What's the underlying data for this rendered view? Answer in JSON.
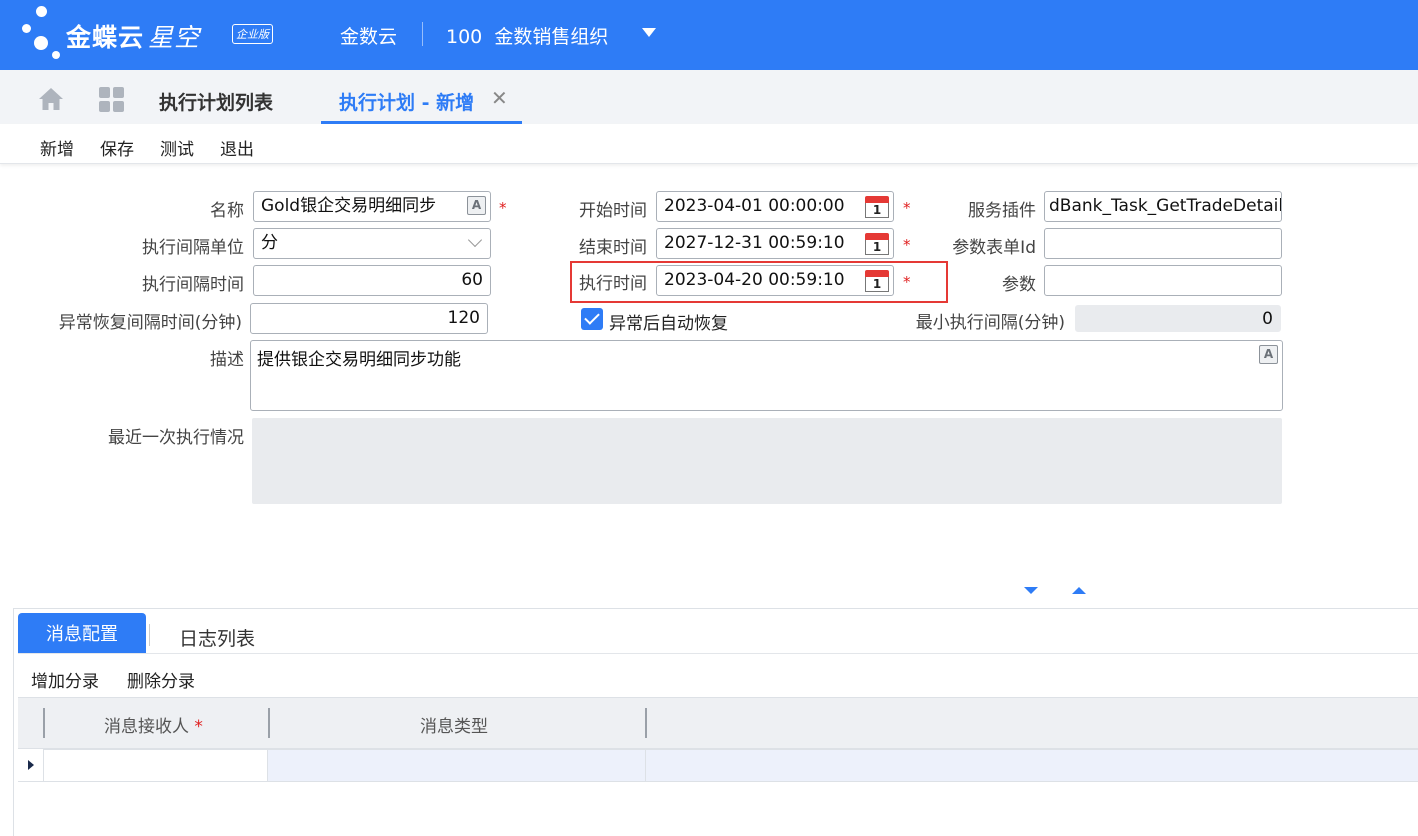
{
  "header": {
    "brand": "金蝶云",
    "brand_star": "星空",
    "edition_badge": "企业版",
    "org_cloud": "金数云",
    "org_name": "100  金数销售组织"
  },
  "tabs": {
    "list_tab": "执行计划列表",
    "active_tab": "执行计划 - 新增",
    "close_symbol": "✕"
  },
  "toolbar": {
    "new": "新增",
    "save": "保存",
    "test": "测试",
    "exit": "退出"
  },
  "form": {
    "name_label": "名称",
    "name_value": "Gold银企交易明细同步",
    "interval_unit_label": "执行间隔单位",
    "interval_unit_value": "分",
    "interval_time_label": "执行间隔时间",
    "interval_time_value": "60",
    "recovery_interval_label": "异常恢复间隔时间(分钟)",
    "recovery_interval_value": "120",
    "start_time_label": "开始时间",
    "start_time_value": "2023-04-01 00:00:00",
    "end_time_label": "结束时间",
    "end_time_value": "2027-12-31 00:59:10",
    "exec_time_label": "执行时间",
    "exec_time_value": "2023-04-20 00:59:10",
    "auto_recover_label": "异常后自动恢复",
    "auto_recover_checked": true,
    "service_plugin_label": "服务插件",
    "service_plugin_value": "dBank_Task_GetTradeDetail",
    "param_form_id_label": "参数表单Id",
    "param_form_id_value": "",
    "param_label": "参数",
    "param_value": "",
    "min_interval_label": "最小执行间隔(分钟)",
    "min_interval_value": "0",
    "desc_label": "描述",
    "desc_value": "提供银企交易明细同步功能",
    "last_exec_label": "最近一次执行情况",
    "last_exec_value": "",
    "required_mark": "*",
    "calendar_day": "1",
    "lang_icon_letter": "A"
  },
  "bottom": {
    "tab_message_config": "消息配置",
    "tab_log_list": "日志列表",
    "add_entry": "增加分录",
    "delete_entry": "删除分录",
    "columns": [
      "消息接收人",
      "消息类型"
    ]
  },
  "colors": {
    "primary": "#2e7cf6",
    "required": "#e02020",
    "highlight": "#e53935"
  }
}
